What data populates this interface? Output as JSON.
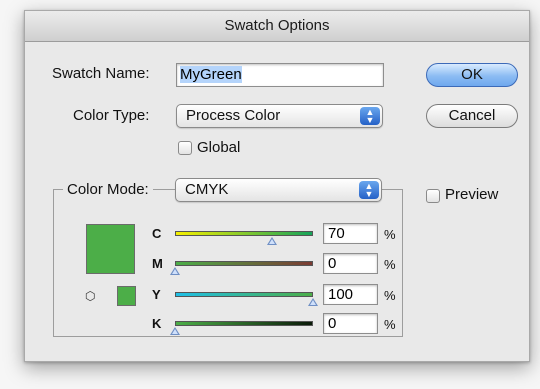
{
  "dialog": {
    "title": "Swatch Options"
  },
  "swatch_name": {
    "label": "Swatch Name:",
    "value": "MyGreen"
  },
  "color_type": {
    "label": "Color Type:",
    "value": "Process Color"
  },
  "global": {
    "label": "Global",
    "checked": false
  },
  "color_mode": {
    "label": "Color Mode:",
    "value": "CMYK"
  },
  "buttons": {
    "ok": "OK",
    "cancel": "Cancel"
  },
  "preview": {
    "label": "Preview",
    "checked": false
  },
  "swatch_color": "#4cae48",
  "channels": [
    {
      "name": "C",
      "value": "70",
      "unit": "%",
      "level": 0.7,
      "gradient": [
        "#f5f000",
        "#16a35a"
      ]
    },
    {
      "name": "M",
      "value": "0",
      "unit": "%",
      "level": 0.0,
      "gradient": [
        "#4cae48",
        "#7a3a32"
      ]
    },
    {
      "name": "Y",
      "value": "100",
      "unit": "%",
      "level": 1.0,
      "gradient": [
        "#1fbfe6",
        "#4cae48"
      ]
    },
    {
      "name": "K",
      "value": "0",
      "unit": "%",
      "level": 0.0,
      "gradient": [
        "#4cae48",
        "#0a1a08"
      ]
    }
  ],
  "icons": {
    "gamut": "cube-icon"
  }
}
